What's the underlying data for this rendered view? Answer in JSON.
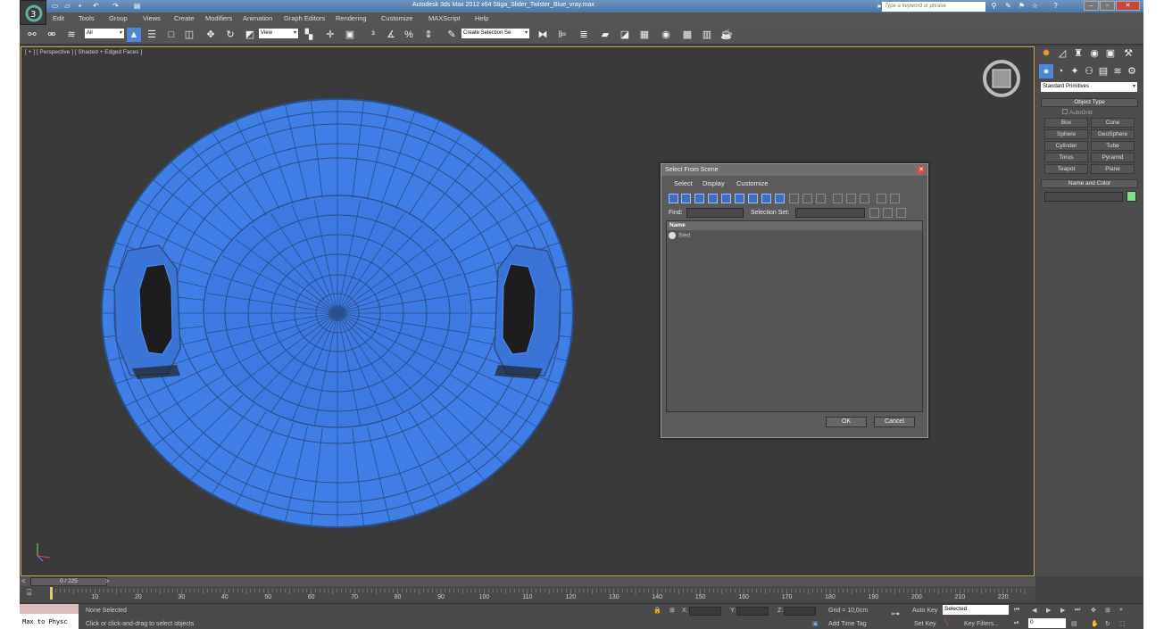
{
  "titlebar": {
    "title": "Autodesk 3ds Max  2012 x64     Stiga_Slider_Twister_Blue_vray.max",
    "search_placeholder": "Type a keyword or phrase"
  },
  "menu": [
    "Edit",
    "Tools",
    "Group",
    "Views",
    "Create",
    "Modifiers",
    "Animation",
    "Graph Editors",
    "Rendering",
    "Customize",
    "MAXScript",
    "Help"
  ],
  "toolbar": {
    "selection_filter": "All",
    "ref_coord": "View",
    "named_selection": "Create Selection Se"
  },
  "viewport": {
    "label": "[ + ] [ Perspective ] [ Shaded + Edged Faces ]",
    "object_color": "#3f7fe6",
    "wire_color": "#2a4f8a"
  },
  "dialog": {
    "title": "Select From Scene",
    "menu": [
      "Select",
      "Display",
      "Customize"
    ],
    "find_label": "Find:",
    "selection_set_label": "Selection Set:",
    "column_name": "Name",
    "items": [
      "Sled"
    ],
    "ok_label": "OK",
    "cancel_label": "Cancel"
  },
  "command_panel": {
    "category": "Standard Primitives",
    "object_type_title": "Object Type",
    "autogrid_label": "AutoGrid",
    "buttons": [
      "Box",
      "Cone",
      "Sphere",
      "GeoSphere",
      "Cylinder",
      "Tube",
      "Torus",
      "Pyramid",
      "Teapot",
      "Plane"
    ],
    "name_color_title": "Name and Color",
    "object_color": "#7fe07f"
  },
  "timeline": {
    "frame_display": "0 / 225",
    "ticks": [
      "10",
      "20",
      "30",
      "40",
      "50",
      "60",
      "70",
      "80",
      "90",
      "100",
      "110",
      "120",
      "130",
      "140",
      "150",
      "160",
      "170",
      "180",
      "190",
      "200",
      "210",
      "220"
    ]
  },
  "status": {
    "maxscript": "Max to Physc",
    "selection": "None Selected",
    "prompt": "Click or click-and-drag to select objects",
    "x_label": "X:",
    "y_label": "Y:",
    "z_label": "Z:",
    "grid": "Grid = 10,0cm",
    "add_time_tag": "Add Time Tag",
    "auto_key": "Auto Key",
    "selected": "Selected",
    "set_key": "Set Key",
    "key_filters": "Key Filters...",
    "frame": "0"
  }
}
